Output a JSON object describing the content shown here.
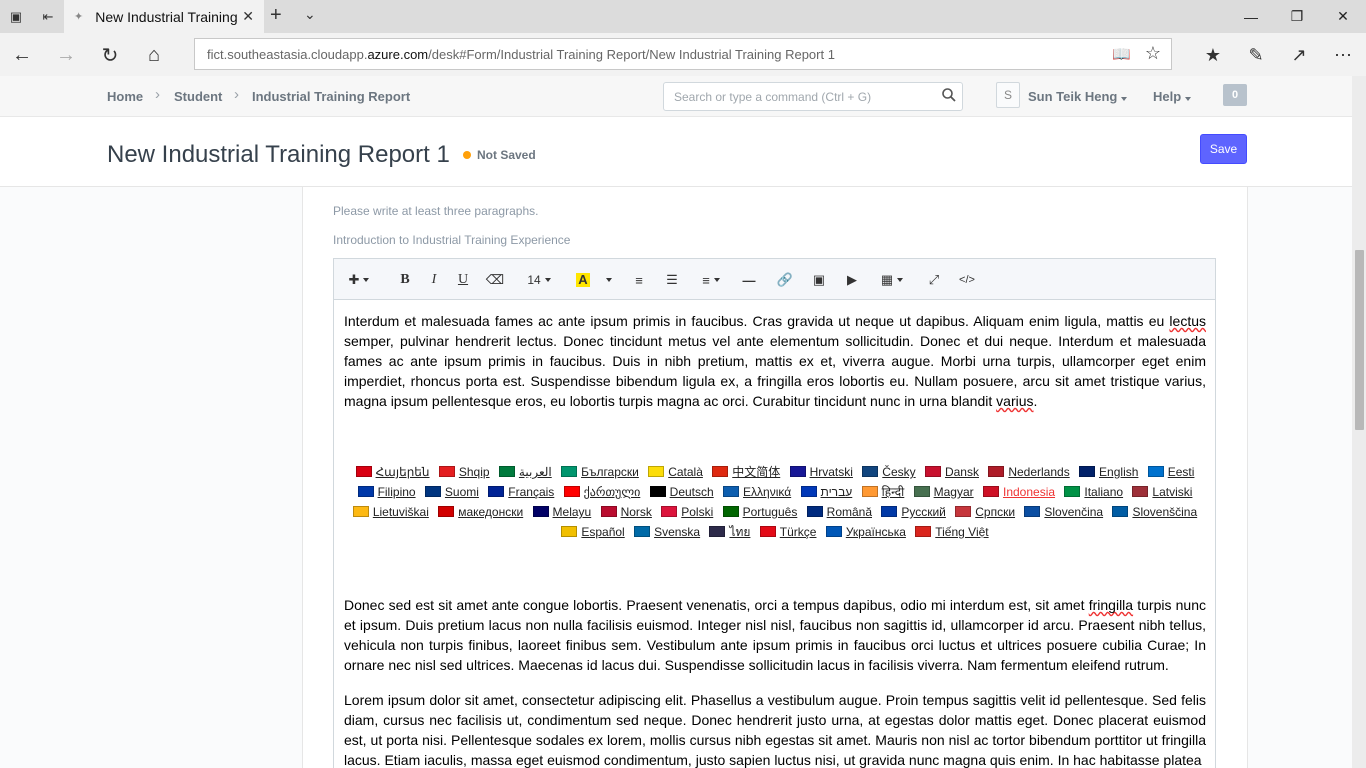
{
  "browser": {
    "tab_title": "New Industrial Training",
    "url_prefix": "fict.southeastasia.cloudapp.",
    "url_host": "azure.com",
    "url_path": "/desk#Form/Industrial Training Report/New Industrial Training Report 1"
  },
  "header": {
    "breadcrumbs": [
      "Home",
      "Student",
      "Industrial Training Report"
    ],
    "search_placeholder": "Search or type a command (Ctrl + G)",
    "avatar_initial": "S",
    "user_name": "Sun Teik Heng",
    "help_label": "Help",
    "notification_count": "0"
  },
  "page": {
    "title": "New Industrial Training Report 1",
    "status": "Not Saved",
    "status_color": "#ffa00a",
    "save_label": "Save",
    "accent_color": "#5e64ff"
  },
  "form": {
    "hint": "Please write at least three paragraphs.",
    "field_label": "Introduction to Industrial Training Experience"
  },
  "toolbar": {
    "font_size": "14",
    "highlight_letter": "A",
    "icons": [
      "magic-icon",
      "bold-icon",
      "italic-icon",
      "underline-icon",
      "eraser-icon",
      "font-size-dropdown",
      "highlight-icon",
      "bulleted-list-icon",
      "numbered-list-icon",
      "align-icon",
      "horizontal-rule-icon",
      "link-icon",
      "image-icon",
      "video-icon",
      "table-icon",
      "fullscreen-icon",
      "code-view-icon"
    ]
  },
  "editor": {
    "p1a": "Interdum et malesuada fames ac ante ipsum primis in faucibus. Cras gravida ut neque ut dapibus. Aliquam enim ligula, mattis eu ",
    "p1b": "lectus",
    "p1c": " semper, pulvinar hendrerit lectus. Donec tincidunt metus vel ante elementum sollicitudin. Donec et dui neque. Interdum et malesuada fames ac ante ipsum primis in faucibus. Duis in nibh pretium, mattis ex et, viverra augue. Morbi urna turpis, ullamcorper eget enim imperdiet, rhoncus porta est. Suspendisse bibendum ligula ex, a fringilla eros lobortis eu. Nullam posuere, arcu sit amet tristique varius, magna ipsum pellentesque eros, eu lobortis turpis magna ac orci. Curabitur tincidunt nunc in urna blandit ",
    "p1d": "varius",
    "p1e": ".",
    "p2a": "Donec sed est sit amet ante congue lobortis. Praesent venenatis, orci a tempus dapibus, odio mi interdum est, sit amet ",
    "p2b": "fringilla",
    "p2c": " turpis nunc et ipsum. Duis pretium lacus non nulla facilisis euismod. Integer nisl nisl, faucibus non sagittis id, ullamcorper id arcu. Praesent nibh tellus, vehicula non turpis finibus, laoreet finibus sem. Vestibulum ante ipsum primis in faucibus orci luctus et ultrices posuere cubilia Curae; In ornare nec nisl sed ultrices. Maecenas id lacus dui. Suspendisse sollicitudin lacus in facilisis viverra. Nam fermentum eleifend rutrum.",
    "p3": "Lorem ipsum dolor sit amet, consectetur adipiscing elit. Phasellus a vestibulum augue. Proin tempus sagittis velit id pellentesque. Sed felis diam, cursus nec facilisis ut, condimentum sed neque. Donec hendrerit justo urna, at egestas dolor mattis eget. Donec placerat euismod est, ut porta nisi. Pellentesque sodales ex lorem, mollis cursus nibh egestas sit amet. Mauris non nisl ac tortor bibendum porttitor ut fringilla lacus. Etiam iaculis, massa eget euismod condimentum, justo sapien luctus nisi, ut gravida nunc magna quis enim. In hac habitasse platea"
  },
  "languages": [
    {
      "label": "Հայերեն",
      "flag": "#d90012"
    },
    {
      "label": "Shqip",
      "flag": "#e41e20"
    },
    {
      "label": "العربية",
      "flag": "#007a3d"
    },
    {
      "label": "Български",
      "flag": "#00966e"
    },
    {
      "label": "Català",
      "flag": "#fcdd09"
    },
    {
      "label": "中文简体",
      "flag": "#de2910"
    },
    {
      "label": "Hrvatski",
      "flag": "#171796"
    },
    {
      "label": "Česky",
      "flag": "#11457e"
    },
    {
      "label": "Dansk",
      "flag": "#c8102e"
    },
    {
      "label": "Nederlands",
      "flag": "#ae1c28"
    },
    {
      "label": "English",
      "flag": "#012169"
    },
    {
      "label": "Eesti",
      "flag": "#0072ce"
    },
    {
      "label": "Filipino",
      "flag": "#0038a8"
    },
    {
      "label": "Suomi",
      "flag": "#003580"
    },
    {
      "label": "Français",
      "flag": "#002395"
    },
    {
      "label": "ქართული",
      "flag": "#ff0000"
    },
    {
      "label": "Deutsch",
      "flag": "#000000"
    },
    {
      "label": "Ελληνικά",
      "flag": "#0d5eaf"
    },
    {
      "label": "עברית",
      "flag": "#0038b8"
    },
    {
      "label": "हिन्दी",
      "flag": "#ff9933"
    },
    {
      "label": "Magyar",
      "flag": "#477050"
    },
    {
      "label": "Indonesia",
      "flag": "#ce1126",
      "active": true
    },
    {
      "label": "Italiano",
      "flag": "#009246"
    },
    {
      "label": "Latviski",
      "flag": "#9e3039"
    },
    {
      "label": "Lietuviškai",
      "flag": "#fdb913"
    },
    {
      "label": "македонски",
      "flag": "#d20000"
    },
    {
      "label": "Melayu",
      "flag": "#010066"
    },
    {
      "label": "Norsk",
      "flag": "#ba0c2f"
    },
    {
      "label": "Polski",
      "flag": "#dc143c"
    },
    {
      "label": "Português",
      "flag": "#006600"
    },
    {
      "label": "Română",
      "flag": "#002b7f"
    },
    {
      "label": "Русский",
      "flag": "#0039a6"
    },
    {
      "label": "Српски",
      "flag": "#c6363c"
    },
    {
      "label": "Slovenčina",
      "flag": "#0b4ea2"
    },
    {
      "label": "Slovenščina",
      "flag": "#005da4"
    },
    {
      "label": "Español",
      "flag": "#f1bf00"
    },
    {
      "label": "Svenska",
      "flag": "#006aa7"
    },
    {
      "label": "ไทย",
      "flag": "#2d2a4a"
    },
    {
      "label": "Türkçe",
      "flag": "#e30a17"
    },
    {
      "label": "Українська",
      "flag": "#0057b7"
    },
    {
      "label": "Tiếng Việt",
      "flag": "#da251d"
    }
  ]
}
